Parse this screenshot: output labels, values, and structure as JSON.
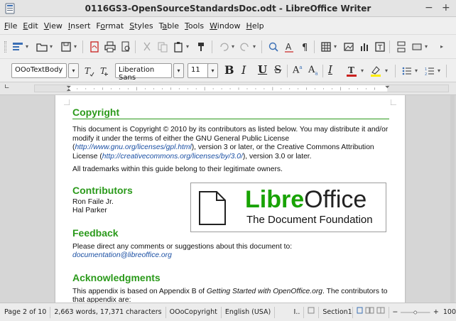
{
  "window": {
    "title": "0116GS3-OpenSourceStandardsDoc.odt - LibreOffice Writer",
    "minimize_glyph": "−",
    "maximize_glyph": "+"
  },
  "menu": {
    "items": [
      {
        "accel": "F",
        "rest": "ile"
      },
      {
        "accel": "E",
        "rest": "dit"
      },
      {
        "accel": "V",
        "rest": "iew"
      },
      {
        "accel": "I",
        "rest": "nsert"
      },
      {
        "accel": "",
        "pre": "F",
        "acc2": "o",
        "rest": "rmat"
      },
      {
        "accel": "S",
        "rest": "tyles"
      },
      {
        "accel": "",
        "pre": "T",
        "acc2": "a",
        "rest": "ble"
      },
      {
        "accel": "T",
        "rest": "ools"
      },
      {
        "accel": "W",
        "rest": "indow"
      },
      {
        "accel": "H",
        "rest": "elp"
      }
    ]
  },
  "formatting": {
    "paragraph_style": "OOoTextBody",
    "font_name": "Liberation Sans",
    "font_size": "11",
    "bold_glyph": "B",
    "italic_glyph": "I",
    "underline_glyph": "U",
    "strike_glyph": "S",
    "superscript_glyph": "A",
    "subscript_glyph": "A",
    "clear_glyph": "I",
    "font_color": "#c9211e",
    "highlight_color": "#ffee00"
  },
  "document": {
    "sections": {
      "copyright_heading": "Copyright",
      "copyright_p1_a": "This document is Copyright © 2010 by its contributors as listed below. You may distribute it and/or modify it under the terms of either the GNU General Public License (",
      "copyright_link1": "http://www.gnu.org/licenses/gpl.html",
      "copyright_p1_b": "), version 3 or later, or the Creative Commons Attribution License (",
      "copyright_link2": "http://creativecommons.org/licenses/by/3.0/",
      "copyright_p1_c": "), version 3.0 or later.",
      "copyright_p2": "All trademarks within this guide belong to their legitimate owners.",
      "contributors_heading": "Contributors",
      "contributor_1": "Ron Faile Jr.",
      "contributor_2": "Hal Parker",
      "feedback_heading": "Feedback",
      "feedback_text": "Please direct any comments or suggestions about this document to:",
      "feedback_email": "documentation@libreoffice.org",
      "ack_heading": "Acknowledgments",
      "ack_text_a": "This appendix is based on Appendix B of ",
      "ack_italic": "Getting Started with OpenOffice.org",
      "ack_text_b": ". The contributors to that appendix are:"
    },
    "logo": {
      "brand_bold": "Libre",
      "brand_light": "Office",
      "tagline": "The Document Foundation",
      "brand_color": "#18a303"
    }
  },
  "status": {
    "page": "Page 2 of 10",
    "words": "2,663 words, 17,371 characters",
    "page_style": "OOoCopyright",
    "language": "English (USA)",
    "insert_mode": "I..",
    "section": "Section1",
    "zoom_minus": "−",
    "zoom_plus": "+",
    "zoom": "100"
  }
}
